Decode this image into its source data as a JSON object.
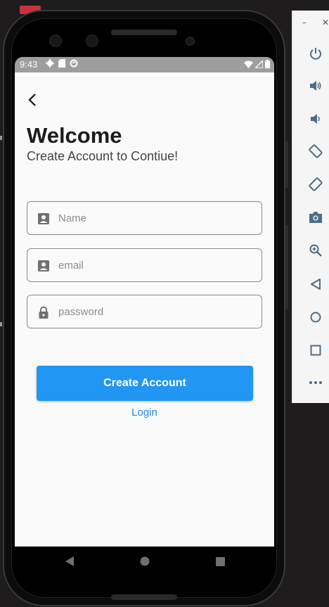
{
  "status_bar": {
    "time": "9:43"
  },
  "screen": {
    "title": "Welcome",
    "subtitle": "Create Account to Contiue!",
    "fields": {
      "name": {
        "placeholder": "Name",
        "value": ""
      },
      "email": {
        "placeholder": "email",
        "value": ""
      },
      "password": {
        "placeholder": "password",
        "value": ""
      }
    },
    "create_button": "Create Account",
    "login_link": "Login"
  },
  "colors": {
    "primary": "#2196f3",
    "link": "#1e88e5",
    "status_bar": "#9e9e9e",
    "screen_bg": "#fafafa",
    "toolbar_icon": "#4d6d86"
  },
  "emulator_toolbar": {
    "icons": [
      "minimize-icon",
      "close-icon",
      "power-icon",
      "volume-up-icon",
      "volume-down-icon",
      "rotate-left-icon",
      "rotate-right-icon",
      "camera-icon",
      "zoom-icon",
      "back-icon",
      "home-icon",
      "overview-icon",
      "more-icon"
    ]
  },
  "nav_bar": {
    "icons": [
      "back-triangle-icon",
      "home-circle-icon",
      "recents-square-icon"
    ]
  }
}
